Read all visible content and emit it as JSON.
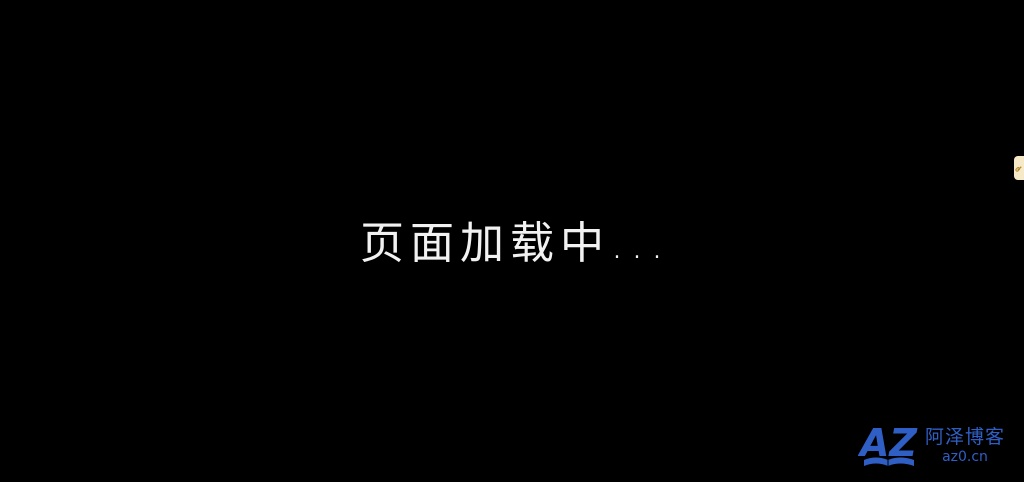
{
  "loading": {
    "text": "页面加载中..."
  },
  "side_tab": {
    "icon": "link-icon",
    "color": "#f5e9c8"
  },
  "watermark": {
    "logo_text": "AZ",
    "site_name": "阿泽博客",
    "site_url": "az0.cn",
    "logo_icon": "book-icon",
    "color": "#2f5fc4"
  },
  "colors": {
    "background": "#000000",
    "text": "#f2f2f2"
  }
}
